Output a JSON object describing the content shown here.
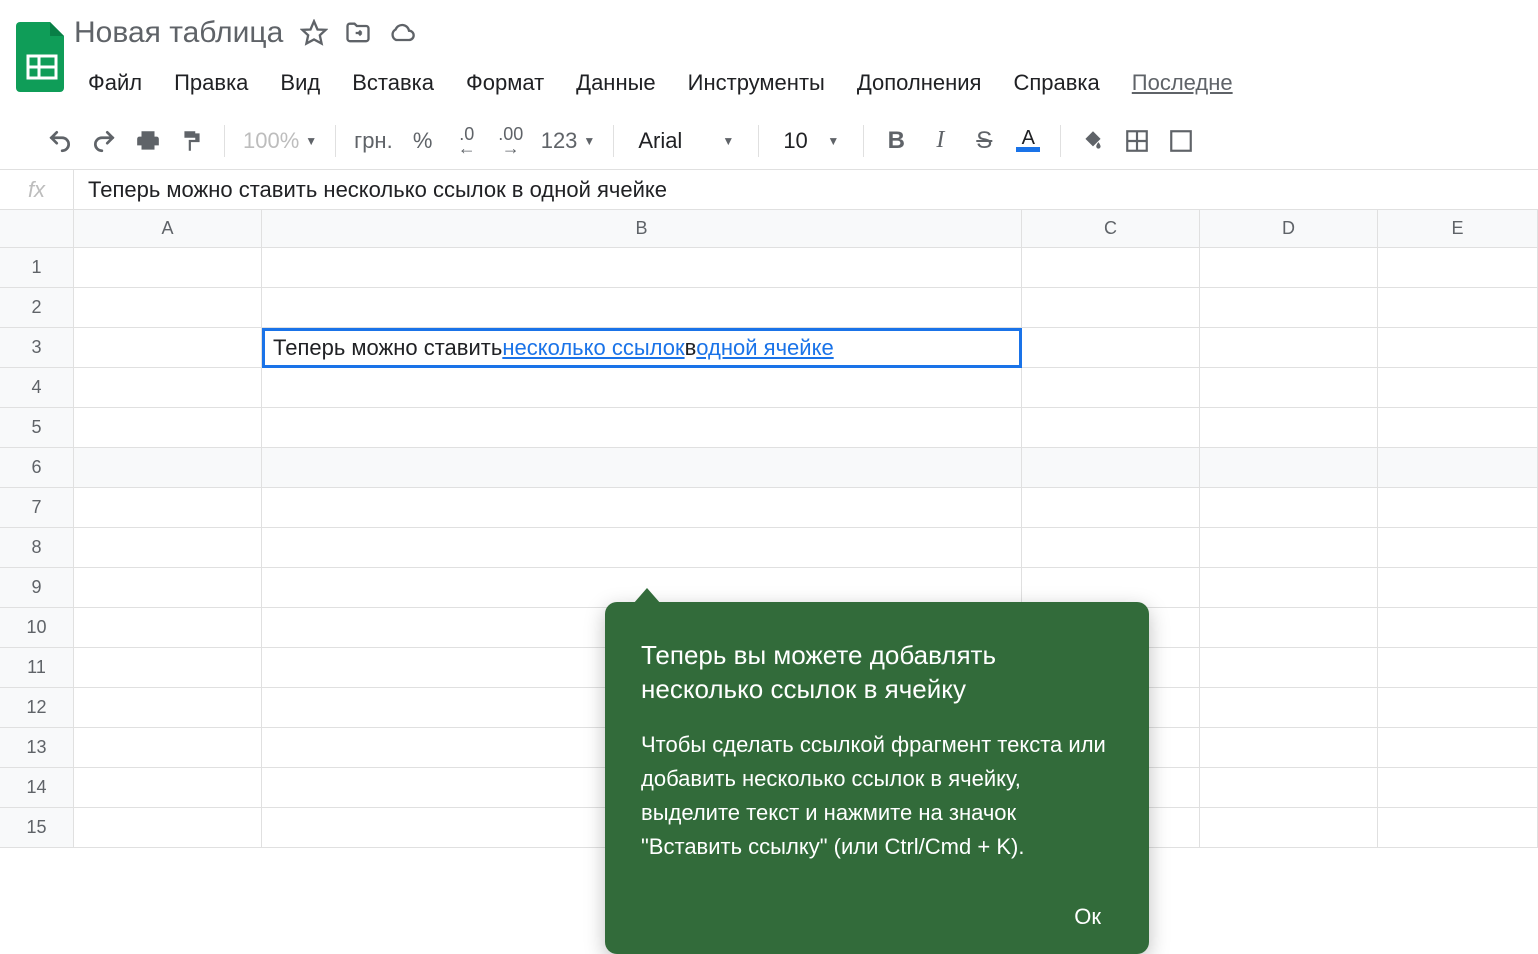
{
  "header": {
    "doc_title": "Новая таблица"
  },
  "menus": {
    "file": "Файл",
    "edit": "Правка",
    "view": "Вид",
    "insert": "Вставка",
    "format": "Формат",
    "data": "Данные",
    "tools": "Инструменты",
    "addons": "Дополнения",
    "help": "Справка",
    "last": "Последне"
  },
  "toolbar": {
    "zoom": "100%",
    "currency": "грн.",
    "percent": "%",
    "dec_less": ".0",
    "dec_more": ".00",
    "num_format": "123",
    "font": "Arial",
    "font_size": "10",
    "bold": "B",
    "italic": "I",
    "strike": "S",
    "textcolor_letter": "A"
  },
  "formula_bar": {
    "fx": "fx",
    "content": "Теперь можно ставить несколько ссылок в одной ячейке"
  },
  "columns": [
    "A",
    "B",
    "C",
    "D",
    "E"
  ],
  "rows": [
    "1",
    "2",
    "3",
    "4",
    "5",
    "6",
    "7",
    "8",
    "9",
    "10",
    "11",
    "12",
    "13",
    "14",
    "15"
  ],
  "active_cell": {
    "ref": "B3",
    "prefix": "Теперь можно ставить ",
    "link1": "несколько ссылок",
    "middle": " в ",
    "link2": "одной ячейке"
  },
  "callout": {
    "title": "Теперь вы можете добавлять несколько ссылок в ячейку",
    "body": "Чтобы сделать ссылкой фрагмент текста или добавить несколько ссылок в ячейку, выделите текст и нажмите на значок \"Вставить ссылку\" (или Ctrl/Cmd + K).",
    "ok": "Ок"
  }
}
